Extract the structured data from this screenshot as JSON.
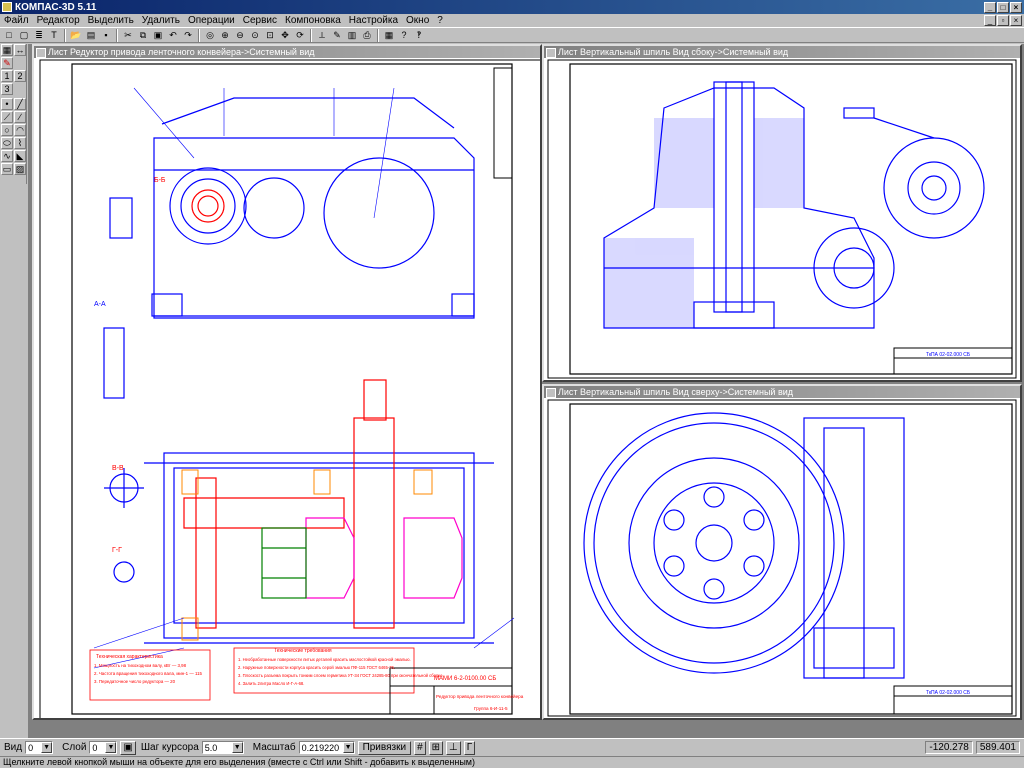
{
  "app": {
    "title": "КОМПАС-3D 5.11"
  },
  "menu": [
    "Файл",
    "Редактор",
    "Выделить",
    "Удалить",
    "Операции",
    "Сервис",
    "Компоновка",
    "Настройка",
    "Окно",
    "?"
  ],
  "toolbar_icons": [
    "new-file-icon",
    "new-fragment-icon",
    "new-spec-icon",
    "new-text-icon",
    "open-icon",
    "print-preview-icon",
    "save-icon",
    "cut-icon",
    "copy-icon",
    "paste-icon",
    "undo-icon",
    "redo-icon",
    "show-all-icon",
    "zoom-in-icon",
    "zoom-out-icon",
    "zoom-window-icon",
    "zoom-scale-icon",
    "pan-icon",
    "refresh-icon",
    "measure-icon",
    "properties-icon",
    "layers-icon",
    "print-icon",
    "library-icon",
    "help-icon",
    "context-help-icon"
  ],
  "left_palette_labels": [
    "1",
    "2",
    "3"
  ],
  "documents": [
    {
      "title": "Лист Редуктор привода ленточного конвейера->Системный вид",
      "stamp_code": "МАМИ 6-2-0100.00 СБ",
      "stamp_name": "Редуктор привода ленточного конвейера",
      "stamp_group": "Группа 6-И-11-5",
      "section_labels": [
        "Б-Б",
        "А-А",
        "В-В",
        "Г-Г"
      ],
      "notes_title": "Техническая характеристика",
      "notes": [
        "1. Мощность на тихоходном валу, кВт — 3,98",
        "2. Частота вращения тихоходного вала, мин-1 — 115",
        "3. Передаточное число редуктора — 20"
      ],
      "tech_title": "Технические требования",
      "tech": [
        "1. Необработанные поверхности литых деталей красить маслостойкой красной эмалью.",
        "2. Наружные поверхности корпуса красить серой эмалью ПФ-115 ГОСТ 6465-76.",
        "3. Плоскость разъема покрыть тонким слоем герметика УТ-34 ГОСТ 24285-80 при окончательной сборке.",
        "4. Залить 2литра Масло И-Г-А-68."
      ]
    },
    {
      "title": "Лист Вертикальный шпиль Вид сбоку->Системный вид",
      "stamp_code": "ТкПА 02-02.000 СБ"
    },
    {
      "title": "Лист Вертикальный шпиль Вид сверху->Системный вид",
      "stamp_code": "ТкПА 02-02.000 СБ"
    }
  ],
  "bottom": {
    "view_label": "Вид",
    "view_value": "0",
    "layer_label": "Слой",
    "layer_value": "0",
    "step_label": "Шаг курсора",
    "step_value": "5.0",
    "scale_label": "Масштаб",
    "scale_value": "0.219220",
    "snap_label": "Привязки",
    "coord_x": "-120.278",
    "coord_y": "589.401"
  },
  "status": "Щелкните левой кнопкой мыши на объекте для его выделения (вместе с Ctrl или Shift - добавить к выделенным)",
  "colors": {
    "drawing_blue": "#0000ff",
    "frame_black": "#000000",
    "hatch_red": "#ff0000",
    "gear_magenta": "#ff00cc",
    "shaft_green": "#008000"
  }
}
